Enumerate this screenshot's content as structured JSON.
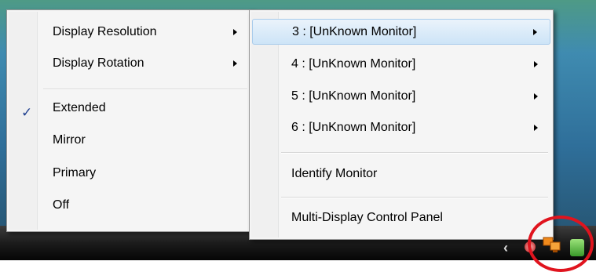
{
  "left_menu": {
    "items": [
      {
        "label": "Display Resolution",
        "submenu": true
      },
      {
        "label": "Display Rotation",
        "submenu": true
      },
      {
        "label": "Extended",
        "checked": true
      },
      {
        "label": "Mirror"
      },
      {
        "label": "Primary"
      },
      {
        "label": "Off"
      }
    ]
  },
  "right_menu": {
    "items": [
      {
        "label": "3 : [UnKnown Monitor]",
        "submenu": true,
        "highlighted": true
      },
      {
        "label": "4 : [UnKnown Monitor]",
        "submenu": true
      },
      {
        "label": "5 : [UnKnown Monitor]",
        "submenu": true
      },
      {
        "label": "6 : [UnKnown Monitor]",
        "submenu": true
      },
      {
        "label": "Identify Monitor"
      },
      {
        "label": "Multi-Display Control Panel"
      }
    ]
  },
  "taskbar": {
    "tray_icons": [
      "show-hidden-icons-chevron",
      "network-icon",
      "display-manager-icon",
      "battery-icon"
    ]
  },
  "colors": {
    "highlight_circle": "#e0141e",
    "menu_background": "#f5f5f5"
  }
}
